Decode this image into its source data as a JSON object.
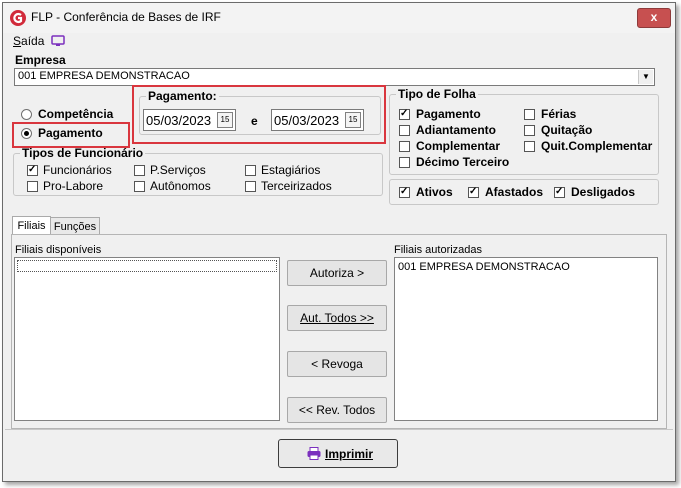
{
  "window": {
    "title": "FLP - Conferência de Bases de IRF",
    "close": "x"
  },
  "menu": {
    "saida": "Saída"
  },
  "empresa": {
    "label": "Empresa",
    "value": "001 EMPRESA DEMONSTRACAO"
  },
  "modo": {
    "competencia": "Competência",
    "pagamento": "Pagamento",
    "selected": "pagamento"
  },
  "pagamento": {
    "legend": "Pagamento:",
    "date_from": "05/03/2023",
    "connector": "e",
    "date_to": "05/03/2023",
    "cal": "15"
  },
  "tipo_folha": {
    "legend": "Tipo de Folha",
    "items": [
      {
        "label": "Pagamento",
        "checked": true
      },
      {
        "label": "Adiantamento",
        "checked": false
      },
      {
        "label": "Complementar",
        "checked": false
      },
      {
        "label": "Décimo Terceiro",
        "checked": false
      },
      {
        "label": "Férias",
        "checked": false
      },
      {
        "label": "Quitação",
        "checked": false
      },
      {
        "label": "Quit.Complementar",
        "checked": false
      }
    ]
  },
  "tipos_funcionario": {
    "legend": "Tipos de Funcionário",
    "items": [
      {
        "label": "Funcionários",
        "checked": true
      },
      {
        "label": "Pro-Labore",
        "checked": false
      },
      {
        "label": "P.Serviços",
        "checked": false
      },
      {
        "label": "Autônomos",
        "checked": false
      },
      {
        "label": "Estagiários",
        "checked": false
      },
      {
        "label": "Terceirizados",
        "checked": false
      }
    ]
  },
  "situacao": {
    "items": [
      {
        "label": "Ativos",
        "checked": true
      },
      {
        "label": "Afastados",
        "checked": true
      },
      {
        "label": "Desligados",
        "checked": true
      }
    ]
  },
  "tabs": [
    {
      "label": "Filiais"
    },
    {
      "label": "Funções"
    }
  ],
  "filiais": {
    "disponiveis_label": "Filiais disponíveis",
    "autorizadas_label": "Filiais autorizadas",
    "autorizadas": [
      "001 EMPRESA DEMONSTRACAO"
    ],
    "buttons": {
      "autoriza": "Autoriza >",
      "aut_todos": "Aut. Todos >>",
      "revoga": "< Revoga",
      "rev_todos": "<< Rev. Todos"
    }
  },
  "footer": {
    "imprimir": "Imprimir"
  },
  "colors": {
    "highlight": "#d9363e",
    "close": "#c75050",
    "accent": "#7b2fbe"
  }
}
